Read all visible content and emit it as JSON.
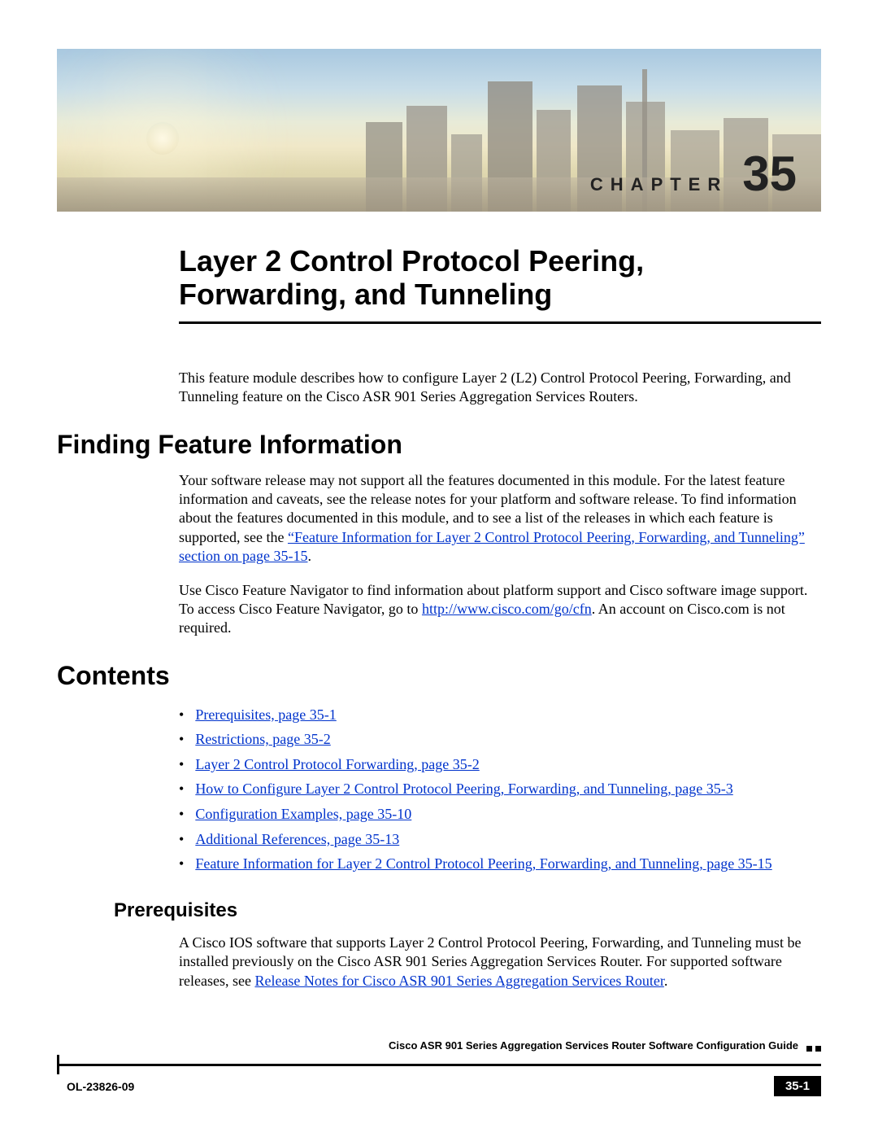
{
  "chapter": {
    "label": "CHAPTER",
    "number": "35"
  },
  "title": "Layer 2 Control Protocol Peering, Forwarding, and Tunneling",
  "intro": "This feature module describes how to configure Layer 2 (L2) Control Protocol Peering, Forwarding, and Tunneling feature on the Cisco ASR 901 Series Aggregation Services Routers.",
  "sections": {
    "finding": {
      "heading": "Finding Feature Information",
      "p1a": "Your software release may not support all the features documented in this module. For the latest feature information and caveats, see the release notes for your platform and software release. To find information about the features documented in this module, and to see a list of the releases in which each feature is supported, see the ",
      "p1link": "“Feature Information for Layer 2 Control Protocol Peering, Forwarding, and Tunneling” section on page 35-15",
      "p1b": ".",
      "p2a": "Use Cisco Feature Navigator to find information about platform support and Cisco software image support. To access Cisco Feature Navigator, go to ",
      "p2link": "http://www.cisco.com/go/cfn",
      "p2b": ". An account on Cisco.com is not required."
    },
    "contents": {
      "heading": "Contents",
      "items": [
        "Prerequisites, page 35-1",
        "Restrictions, page 35-2",
        "Layer 2 Control Protocol Forwarding, page 35-2",
        "How to Configure Layer 2 Control Protocol Peering, Forwarding, and Tunneling, page 35-3",
        "Configuration Examples, page 35-10",
        "Additional References, page 35-13",
        "Feature Information for Layer 2 Control Protocol Peering, Forwarding, and Tunneling, page 35-15"
      ]
    },
    "prereq": {
      "heading": "Prerequisites",
      "pa": "A Cisco IOS software that supports Layer 2 Control Protocol Peering, Forwarding, and Tunneling must be installed previously on the Cisco ASR 901 Series Aggregation Services Router. For supported software releases, see ",
      "plink": "Release Notes for Cisco ASR 901 Series Aggregation Services Router",
      "pb": "."
    }
  },
  "footer": {
    "guide": "Cisco ASR 901 Series Aggregation Services Router Software Configuration Guide",
    "docnum": "OL-23826-09",
    "pagenum": "35-1"
  }
}
